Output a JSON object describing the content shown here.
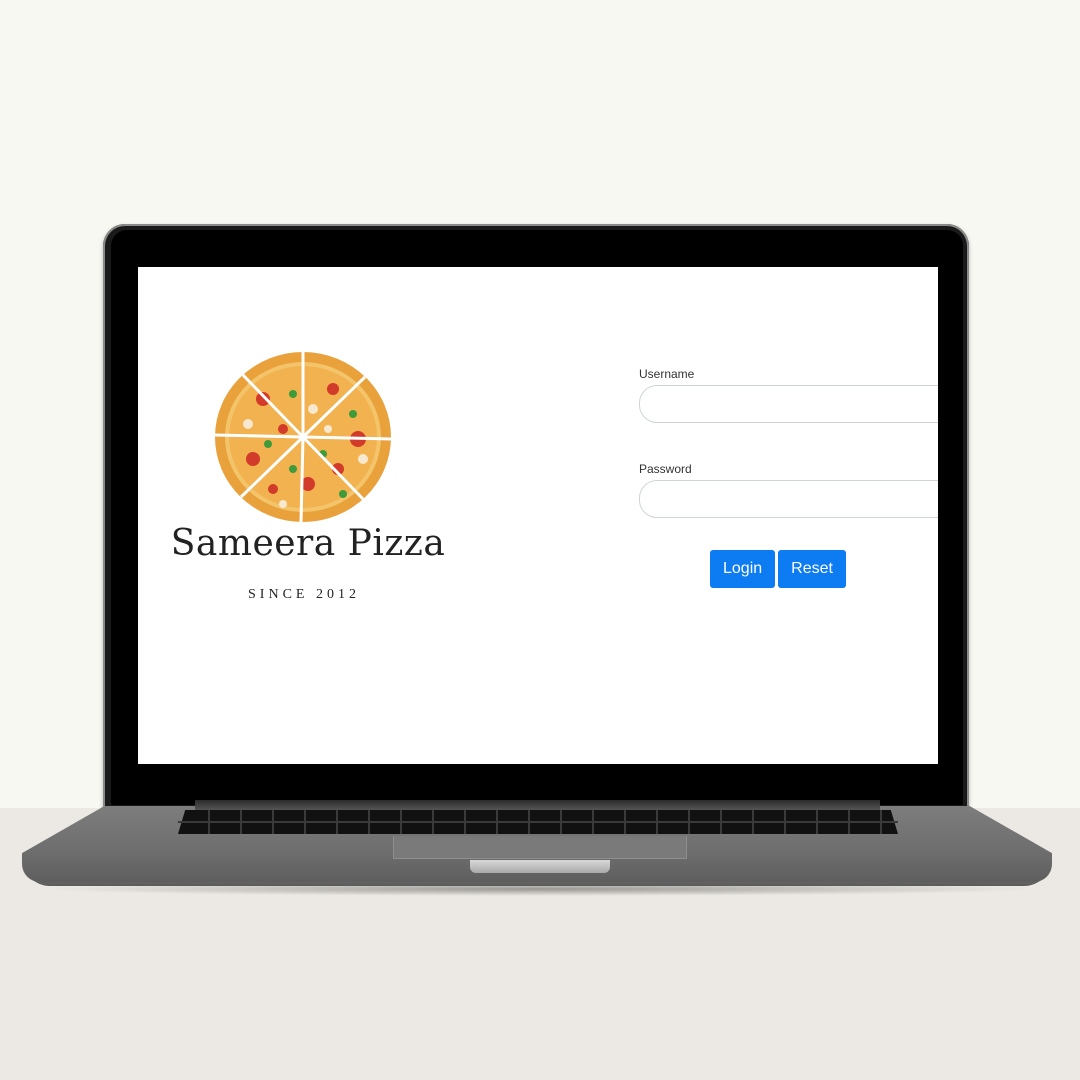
{
  "brand": {
    "name": "Sameera Pizza",
    "tagline": "SINCE 2012"
  },
  "login_form": {
    "username_label": "Username",
    "username_value": "",
    "password_label": "Password",
    "password_value": "",
    "login_label": "Login",
    "reset_label": "Reset"
  },
  "colors": {
    "button": "#0d7cf2",
    "background": "#f8f8f3",
    "table": "#ece9e4"
  }
}
